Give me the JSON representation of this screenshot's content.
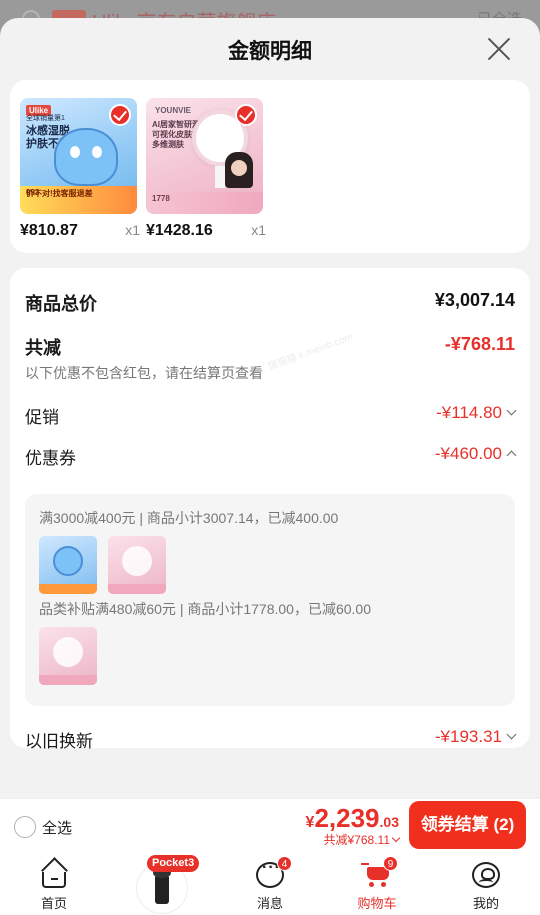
{
  "background_page": {
    "shop_name": "Ulike京东自营旗舰店",
    "right_action": "已全选"
  },
  "sheet": {
    "title": "金额明细"
  },
  "products": [
    {
      "price": "¥810.87",
      "qty": "x1",
      "thumb": {
        "brand": "Ulike",
        "head": "冰感湿脱\n护肤不留黑",
        "sub": "全球销量第1",
        "banner": "价不对!找客服退差",
        "price": "993"
      }
    },
    {
      "price": "¥1428.16",
      "qty": "x1",
      "thumb": {
        "brand": "YOUNVIE",
        "head": "AI居家智研测肤\n可视化皮肤管理\n多维测肤",
        "sub": "",
        "banner": "",
        "price": "1778"
      }
    }
  ],
  "summary": {
    "total_label": "商品总价",
    "total_value": "¥3,007.14",
    "discount_label": "共减",
    "discount_value": "-¥768.11",
    "note": "以下优惠不包含红包，请在结算页查看",
    "promo_label": "促销",
    "promo_value": "-¥114.80",
    "coupon_label": "优惠券",
    "coupon_value": "-¥460.00",
    "coupon_details": [
      "满3000减400元 | 商品小计3007.14，已减400.00",
      "品类补贴满480减60元 | 商品小计1778.00，已减60.00"
    ],
    "tradein_label": "以旧换新",
    "tradein_value": "-¥193.31"
  },
  "watermark": "猫猫猫 k.meinb.com",
  "bottom_bar": {
    "select_all": "全选",
    "currency": "¥",
    "amount_int": "2,239",
    "amount_dec": ".03",
    "saved": "共减¥768.11",
    "checkout": "领券结算 (2)"
  },
  "tabs": [
    {
      "label": "首页",
      "icon": "home-icon",
      "active": false
    },
    {
      "label": "Pocket3",
      "icon": "pocket3-promo",
      "active": false
    },
    {
      "label": "消息",
      "icon": "message-icon",
      "badge": "4",
      "active": false
    },
    {
      "label": "购物车",
      "icon": "cart-icon",
      "badge": "9",
      "active": true
    },
    {
      "label": "我的",
      "icon": "profile-icon",
      "active": false
    }
  ],
  "colors": {
    "accent_red": "#e8302a",
    "checkout_red": "#f0301c",
    "sheet_bg": "#f2f2f2"
  }
}
